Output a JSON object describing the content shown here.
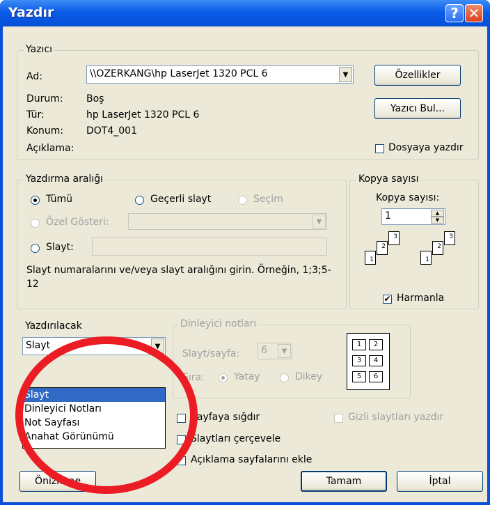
{
  "window": {
    "title": "Yazdır"
  },
  "printer": {
    "group_label": "Yazıcı",
    "name_label": "Ad:",
    "name_value": "\\\\OZERKANG\\hp LaserJet 1320 PCL 6",
    "status_label": "Durum:",
    "status_value": "Boş",
    "type_label": "Tür:",
    "type_value": "hp LaserJet 1320 PCL 6",
    "location_label": "Konum:",
    "location_value": "DOT4_001",
    "comment_label": "Açıklama:",
    "properties_button": "Özellikler",
    "find_button": "Yazıcı Bul...",
    "print_to_file": "Dosyaya yazdır"
  },
  "range": {
    "group_label": "Yazdırma aralığı",
    "all": "Tümü",
    "current": "Geçerli slayt",
    "selection": "Seçim",
    "custom_show": "Özel Gösteri:",
    "slides": "Slayt:",
    "help_text": "Slayt numaralarını ve/veya slayt aralığını girin. Örneğin, 1;3;5-12"
  },
  "copies": {
    "group_label": "Kopya sayısı",
    "count_label": "Kopya sayısı:",
    "count_value": "1",
    "collate": "Harmanla",
    "page_numbers": [
      "1",
      "2",
      "3"
    ]
  },
  "print_what": {
    "label": "Yazdırılacak",
    "selected": "Slayt",
    "options": [
      "Slayt",
      "Dinleyici Notları",
      "Not Sayfası",
      "Anahat Görünümü"
    ]
  },
  "handouts": {
    "group_label": "Dinleyici notları",
    "per_page_label": "Slayt/sayfa:",
    "per_page_value": "6",
    "order_label": "Sıra:",
    "horizontal": "Yatay",
    "vertical": "Dikey",
    "preview_numbers": [
      "1",
      "2",
      "3",
      "4",
      "5",
      "6"
    ]
  },
  "options": {
    "fit": "Sayfaya sığdır",
    "frame": "Slaytları çerçevele",
    "comments": "Açıklama sayfalarını ekle",
    "hidden": "Gizli slaytları yazdır"
  },
  "buttons": {
    "preview": "Önizleme",
    "ok": "Tamam",
    "cancel": "İptal"
  },
  "colors": {
    "title_bar": "#0b5ce8",
    "dialog_bg": "#ece9d8",
    "highlight": "#316ac5",
    "annotation": "#ec1c24"
  }
}
